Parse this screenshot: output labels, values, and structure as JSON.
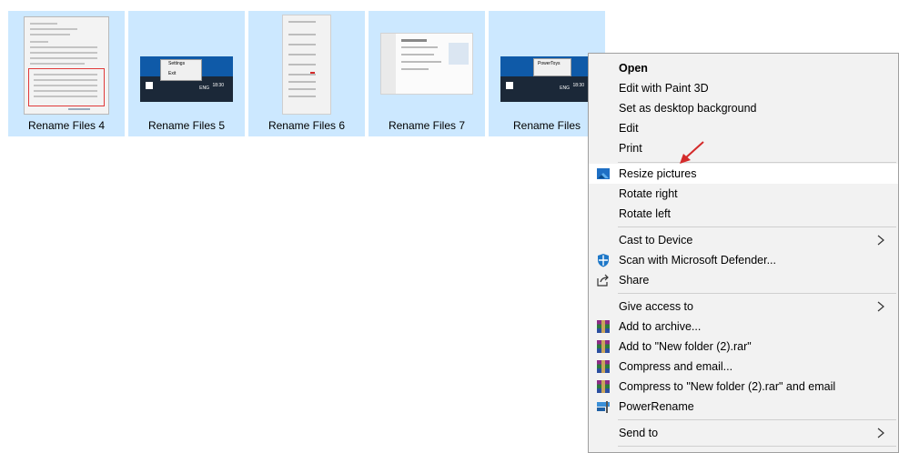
{
  "files": [
    {
      "label": "Rename Files 4"
    },
    {
      "label": "Rename Files 5"
    },
    {
      "label": "Rename Files 6"
    },
    {
      "label": "Rename Files 7"
    },
    {
      "label": "Rename Files"
    }
  ],
  "thumbnails": {
    "files5_menu": [
      "Settings",
      "Exit"
    ],
    "taskbar_time": "18:30",
    "taskbar_date": "06-01-2021",
    "taskbar_lang": "ENG",
    "files_tooltip": "PowerToys"
  },
  "context_menu": {
    "items": [
      {
        "label": "Open",
        "bold": true
      },
      {
        "label": "Edit with Paint 3D"
      },
      {
        "label": "Set as desktop background"
      },
      {
        "label": "Edit"
      },
      {
        "label": "Print"
      },
      {
        "label": "Resize pictures",
        "icon": "resize-pictures-icon",
        "highlighted": true
      },
      {
        "label": "Rotate right"
      },
      {
        "label": "Rotate left"
      },
      {
        "label": "Cast to Device",
        "submenu": true
      },
      {
        "label": "Scan with Microsoft Defender...",
        "icon": "defender-icon"
      },
      {
        "label": "Share",
        "icon": "share-icon"
      },
      {
        "label": "Give access to",
        "submenu": true
      },
      {
        "label": "Add to archive...",
        "icon": "winrar-icon"
      },
      {
        "label": "Add to \"New folder (2).rar\"",
        "icon": "winrar-icon"
      },
      {
        "label": "Compress and email...",
        "icon": "winrar-icon"
      },
      {
        "label": "Compress to \"New folder (2).rar\" and email",
        "icon": "winrar-icon"
      },
      {
        "label": "PowerRename",
        "icon": "powerrename-icon"
      },
      {
        "label": "Send to",
        "submenu": true
      }
    ]
  },
  "colors": {
    "selection": "#cce8ff",
    "menu_background": "#f2f2f2",
    "annotation_arrow": "#d42b2b"
  }
}
